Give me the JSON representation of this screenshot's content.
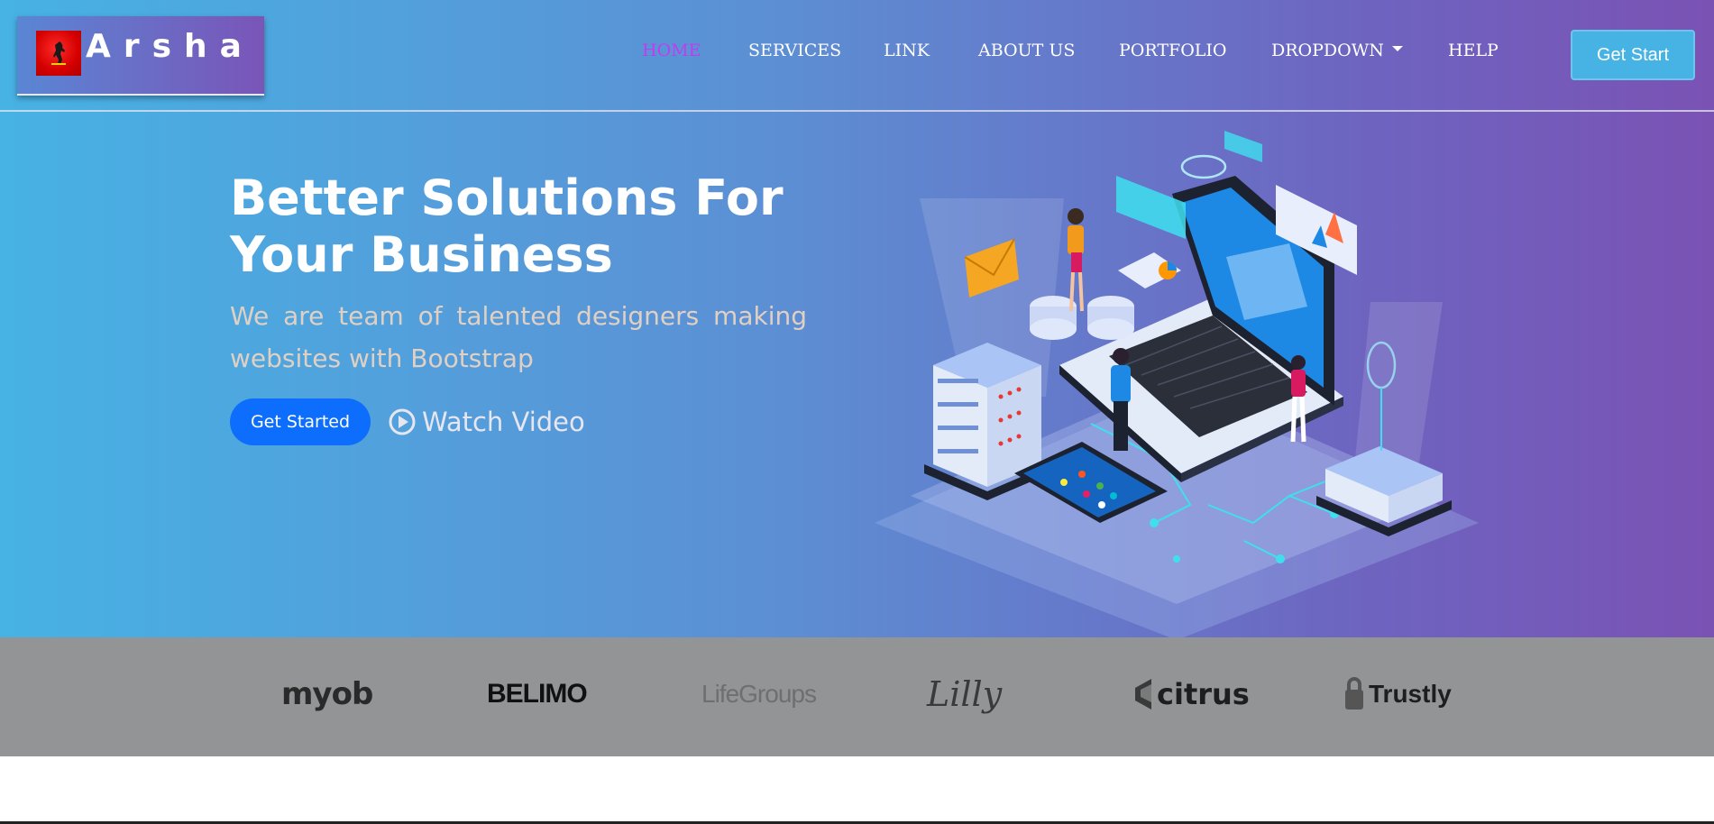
{
  "brand": {
    "name": "Arsha",
    "accent": "#47b2e4"
  },
  "nav": {
    "items": [
      {
        "label": "HOME",
        "active": true
      },
      {
        "label": "SERVICES"
      },
      {
        "label": "LINK"
      },
      {
        "label": "ABOUT US"
      },
      {
        "label": "PORTFOLIO"
      },
      {
        "label": "DROPDOWN",
        "has_caret": true
      },
      {
        "label": "HELP"
      }
    ],
    "cta_label": "Get Start"
  },
  "hero": {
    "title": "Better Solutions For Your Business",
    "subtitle": "We are team of talented designers making websites with Bootstrap",
    "primary_button": "Get Started",
    "video_link": "Watch Video",
    "illustration": "isometric-laptop-servers-illustration"
  },
  "clients": [
    {
      "name": "myob",
      "icon": "myob-logo"
    },
    {
      "name": "BELIMO",
      "icon": "belimo-logo"
    },
    {
      "name": "LifeGroups",
      "icon": "lifegroups-logo"
    },
    {
      "name": "Lilly",
      "icon": "lilly-logo"
    },
    {
      "name": "citrus",
      "icon": "citrus-logo"
    },
    {
      "name": "Trustly",
      "icon": "trustly-logo"
    }
  ],
  "colors": {
    "hero_start": "#47b2e4",
    "hero_end": "#7a52b4",
    "active_nav": "#c23bf0",
    "primary_button": "#0d6efd",
    "clients_bar": "#929495"
  }
}
